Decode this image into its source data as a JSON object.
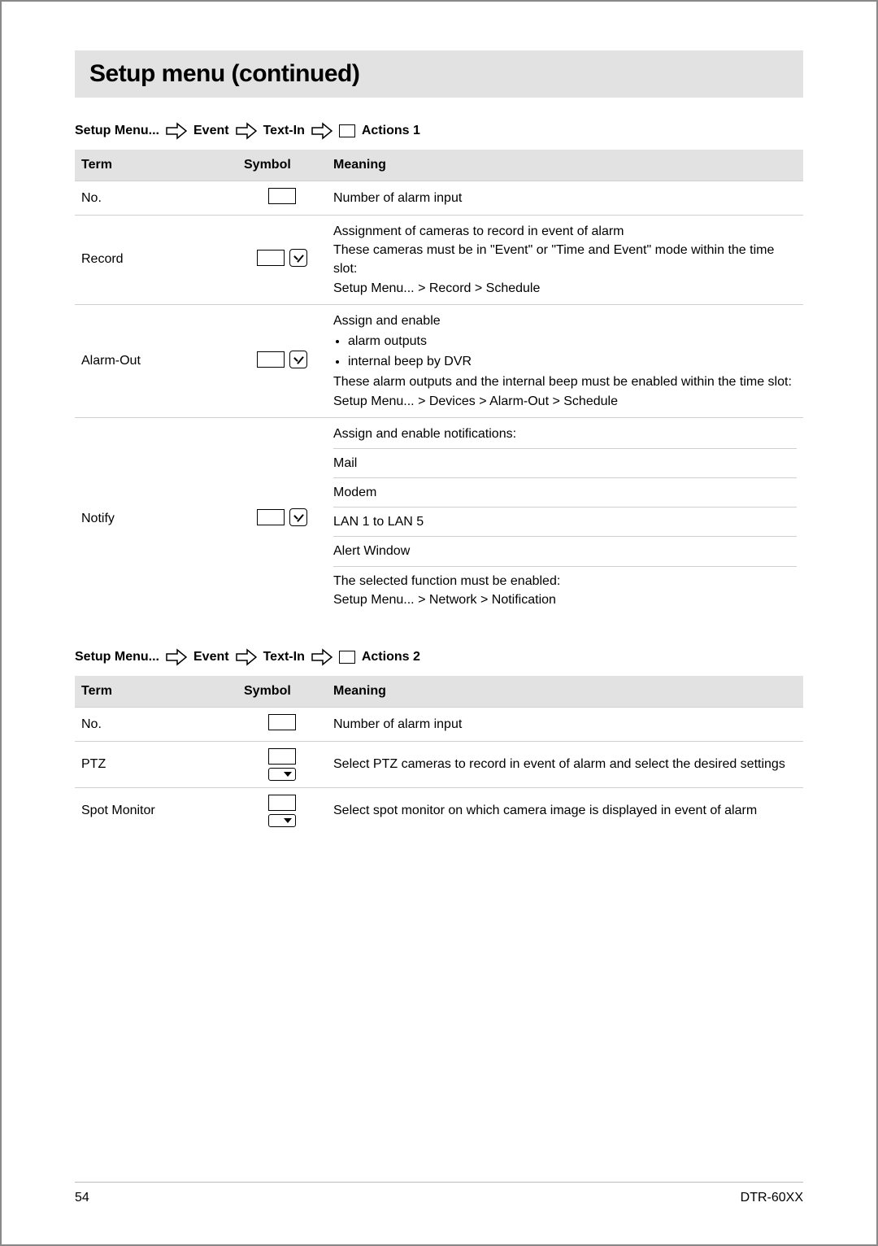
{
  "title": "Setup menu (continued)",
  "breadcrumb1": {
    "root": "Setup Menu...",
    "l1": "Event",
    "l2": "Text-In",
    "l3": "Actions 1"
  },
  "breadcrumb2": {
    "root": "Setup Menu...",
    "l1": "Event",
    "l2": "Text-In",
    "l3": "Actions 2"
  },
  "header": {
    "term": "Term",
    "symbol": "Symbol",
    "meaning": "Meaning"
  },
  "table1": {
    "rows": [
      {
        "term": "No.",
        "symbol": "text",
        "meaning_plain": "Number of alarm input"
      },
      {
        "term": "Record",
        "symbol": "text_check",
        "meaning_lines": [
          "Assignment of cameras to record in event of alarm",
          "These cameras must be in \"Event\" or \"Time and Event\" mode within the time slot:",
          "Setup Menu... > Record > Schedule"
        ]
      },
      {
        "term": "Alarm-Out",
        "symbol": "text_check",
        "meaning_intro": "Assign and enable",
        "meaning_bullets": [
          "alarm outputs",
          "internal beep by DVR"
        ],
        "meaning_trail": [
          "These alarm outputs and the internal beep must be enabled within the time slot:",
          "Setup Menu... > Devices > Alarm-Out > Schedule"
        ]
      },
      {
        "term": "Notify",
        "symbol": "text_check",
        "meaning_sections": [
          "Assign and enable notifications:",
          "Mail",
          "Modem",
          "LAN 1 to LAN 5",
          "Alert Window"
        ],
        "meaning_final": [
          "The selected function must be enabled:",
          "Setup Menu... > Network > Notification"
        ]
      }
    ]
  },
  "table2": {
    "rows": [
      {
        "term": "No.",
        "symbol": "text",
        "meaning_plain": "Number of alarm input"
      },
      {
        "term": "PTZ",
        "symbol": "text_drop",
        "meaning_plain": "Select PTZ cameras to record in event of alarm and select the desired settings"
      },
      {
        "term": "Spot Monitor",
        "symbol": "text_drop",
        "meaning_plain": "Select spot monitor on which camera image is displayed in event of alarm"
      }
    ]
  },
  "footer": {
    "page": "54",
    "model": "DTR-60XX"
  }
}
